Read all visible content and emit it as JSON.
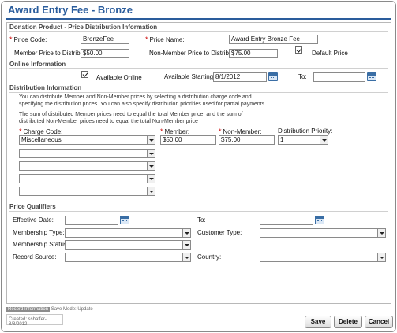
{
  "title": "Award Entry Fee - Bronze",
  "sections": {
    "donation": "Donation Product - Price Distribution Information",
    "online": "Online Information",
    "distribution": "Distribution Information",
    "qualifiers": "Price Qualifiers"
  },
  "price": {
    "code_label": "Price Code:",
    "code_value": "BronzeFee",
    "name_label": "Price Name:",
    "name_value": "Award Entry Bronze Fee",
    "member_label": "Member Price to Distribute:",
    "member_value": "$50.00",
    "nonmember_label": "Non-Member Price to Distribute:",
    "nonmember_value": "$75.00",
    "default_label": "Default Price",
    "default_checked": true
  },
  "online": {
    "available_label": "Available Online",
    "available_checked": true,
    "starting_label": "Available Starting:",
    "starting_value": "8/1/2012",
    "to_label": "To:",
    "to_value": ""
  },
  "distribution": {
    "note1": "You can distribute Member and Non-Member prices by selecting a distribution charge code and specifying the distribution prices. You can also specify distribution priorities used for partial payments",
    "note2": "The sum of distributed Member prices need to equal the total Member price, and the sum of distributed Non-Member prices need to equal the total Non-Member price",
    "charge_code_label": "Charge Code:",
    "member_label": "Member:",
    "nonmember_label": "Non-Member:",
    "priority_label": "Distribution Priority:",
    "rows": [
      {
        "charge_code": "Miscellaneous",
        "member": "$50.00",
        "nonmember": "$75.00",
        "priority": "1"
      },
      {
        "charge_code": ""
      },
      {
        "charge_code": ""
      },
      {
        "charge_code": ""
      },
      {
        "charge_code": ""
      }
    ]
  },
  "qualifiers": {
    "effective_label": "Effective Date:",
    "effective_value": "",
    "to_label": "To:",
    "to_value": "",
    "membership_type_label": "Membership Type:",
    "membership_type_value": "",
    "customer_type_label": "Customer Type:",
    "customer_type_value": "",
    "membership_status_label": "Membership Status:",
    "membership_status_value": "",
    "record_source_label": "Record Source:",
    "record_source_value": "",
    "country_label": "Country:",
    "country_value": ""
  },
  "footer": {
    "record_info_tag": "Record Information",
    "save_mode": "Save Mode: Update",
    "created": "Created: sshaffer-8/8/2012"
  },
  "buttons": {
    "save": "Save",
    "delete": "Delete",
    "cancel": "Cancel"
  },
  "colors": {
    "title": "#2a5c9c",
    "required": "#cc0000"
  },
  "icons": {
    "calendar": "calendar-icon",
    "dropdown": "chevron-down-icon",
    "checkbox": "checkbox"
  }
}
